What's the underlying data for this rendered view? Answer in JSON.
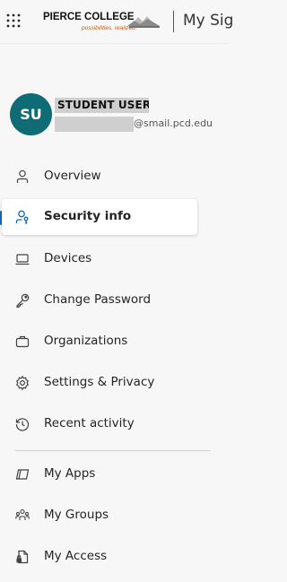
{
  "header": {
    "logo": {
      "name": "PIERCE COLLEGE",
      "tagline": "possibilities. realized."
    },
    "app_title": "My Sig"
  },
  "user": {
    "initials": "SU",
    "name": "STUDENT USER",
    "email_suffix": "@smail.pcd.edu"
  },
  "colors": {
    "accent": "#0f6cbd",
    "avatar": "#0f6c74",
    "logo_accent": "#c25a1b"
  },
  "nav": {
    "items": [
      {
        "label": "Overview",
        "icon": "person-icon"
      },
      {
        "label": "Security info",
        "icon": "person-key-icon",
        "active": true
      },
      {
        "label": "Devices",
        "icon": "laptop-icon"
      },
      {
        "label": "Change Password",
        "icon": "key-icon"
      },
      {
        "label": "Organizations",
        "icon": "briefcase-icon"
      },
      {
        "label": "Settings & Privacy",
        "icon": "gear-icon"
      },
      {
        "label": "Recent activity",
        "icon": "history-icon"
      }
    ],
    "apps": [
      {
        "label": "My Apps",
        "icon": "apps-icon"
      },
      {
        "label": "My Groups",
        "icon": "people-icon"
      },
      {
        "label": "My Access",
        "icon": "lock-document-icon"
      }
    ]
  }
}
